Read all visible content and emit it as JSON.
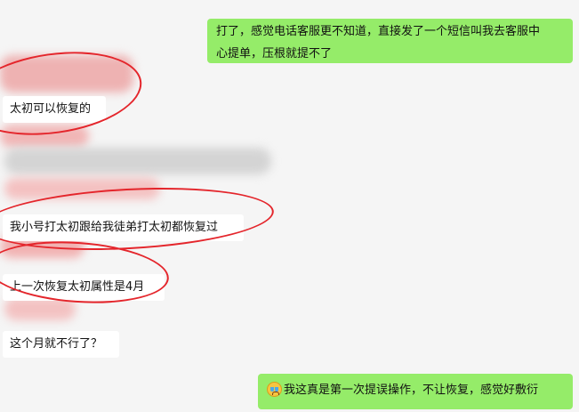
{
  "messages": {
    "m1": {
      "line1": "打了，感觉电话客服更不知道，直接发了一个短信叫我去客服中",
      "line2": "心提单，压根就提不了"
    },
    "m2": "太初可以恢复的",
    "m3": "我小号打太初跟给我徒弟打太初都恢复过",
    "m4": "上一次恢复太初属性是4月",
    "m5": "这个月就不行了？",
    "m6": "我这真是第一次提误操作，不让恢复，感觉好敷衍"
  },
  "emoji_name": "crying-emoji",
  "colors": {
    "self_bubble": "#95ec69",
    "other_bubble": "#ffffff",
    "background": "#f5f5f5",
    "annotation": "#e4252b"
  }
}
